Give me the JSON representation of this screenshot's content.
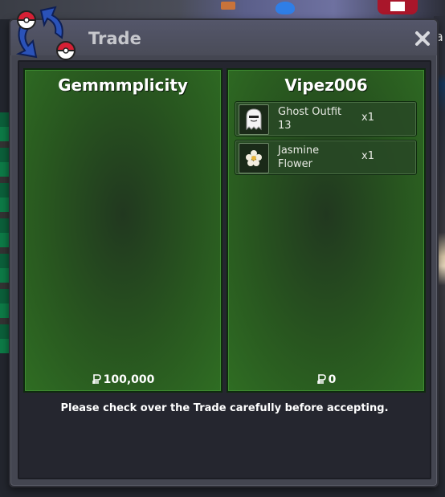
{
  "window": {
    "title": "Trade",
    "close_icon": "close-icon",
    "logo_icon": "trade-arrows-icon"
  },
  "background": {
    "partial_text": "a"
  },
  "panels": {
    "left": {
      "player_name": "Gemmmplicity",
      "money": "100,000",
      "items": []
    },
    "right": {
      "player_name": "Vipez006",
      "money": "0",
      "items": [
        {
          "name": "Ghost Outfit 13",
          "quantity": "x1",
          "icon": "ghost-outfit-icon"
        },
        {
          "name": "Jasmine Flower",
          "quantity": "x1",
          "icon": "jasmine-flower-icon"
        }
      ]
    }
  },
  "instruction": "Please check over the Trade carefully before accepting.",
  "colors": {
    "panel_green": "#2f6d23",
    "window_gray": "#444651",
    "logo_blue": "#2a52b8",
    "logo_red": "#d62035"
  }
}
